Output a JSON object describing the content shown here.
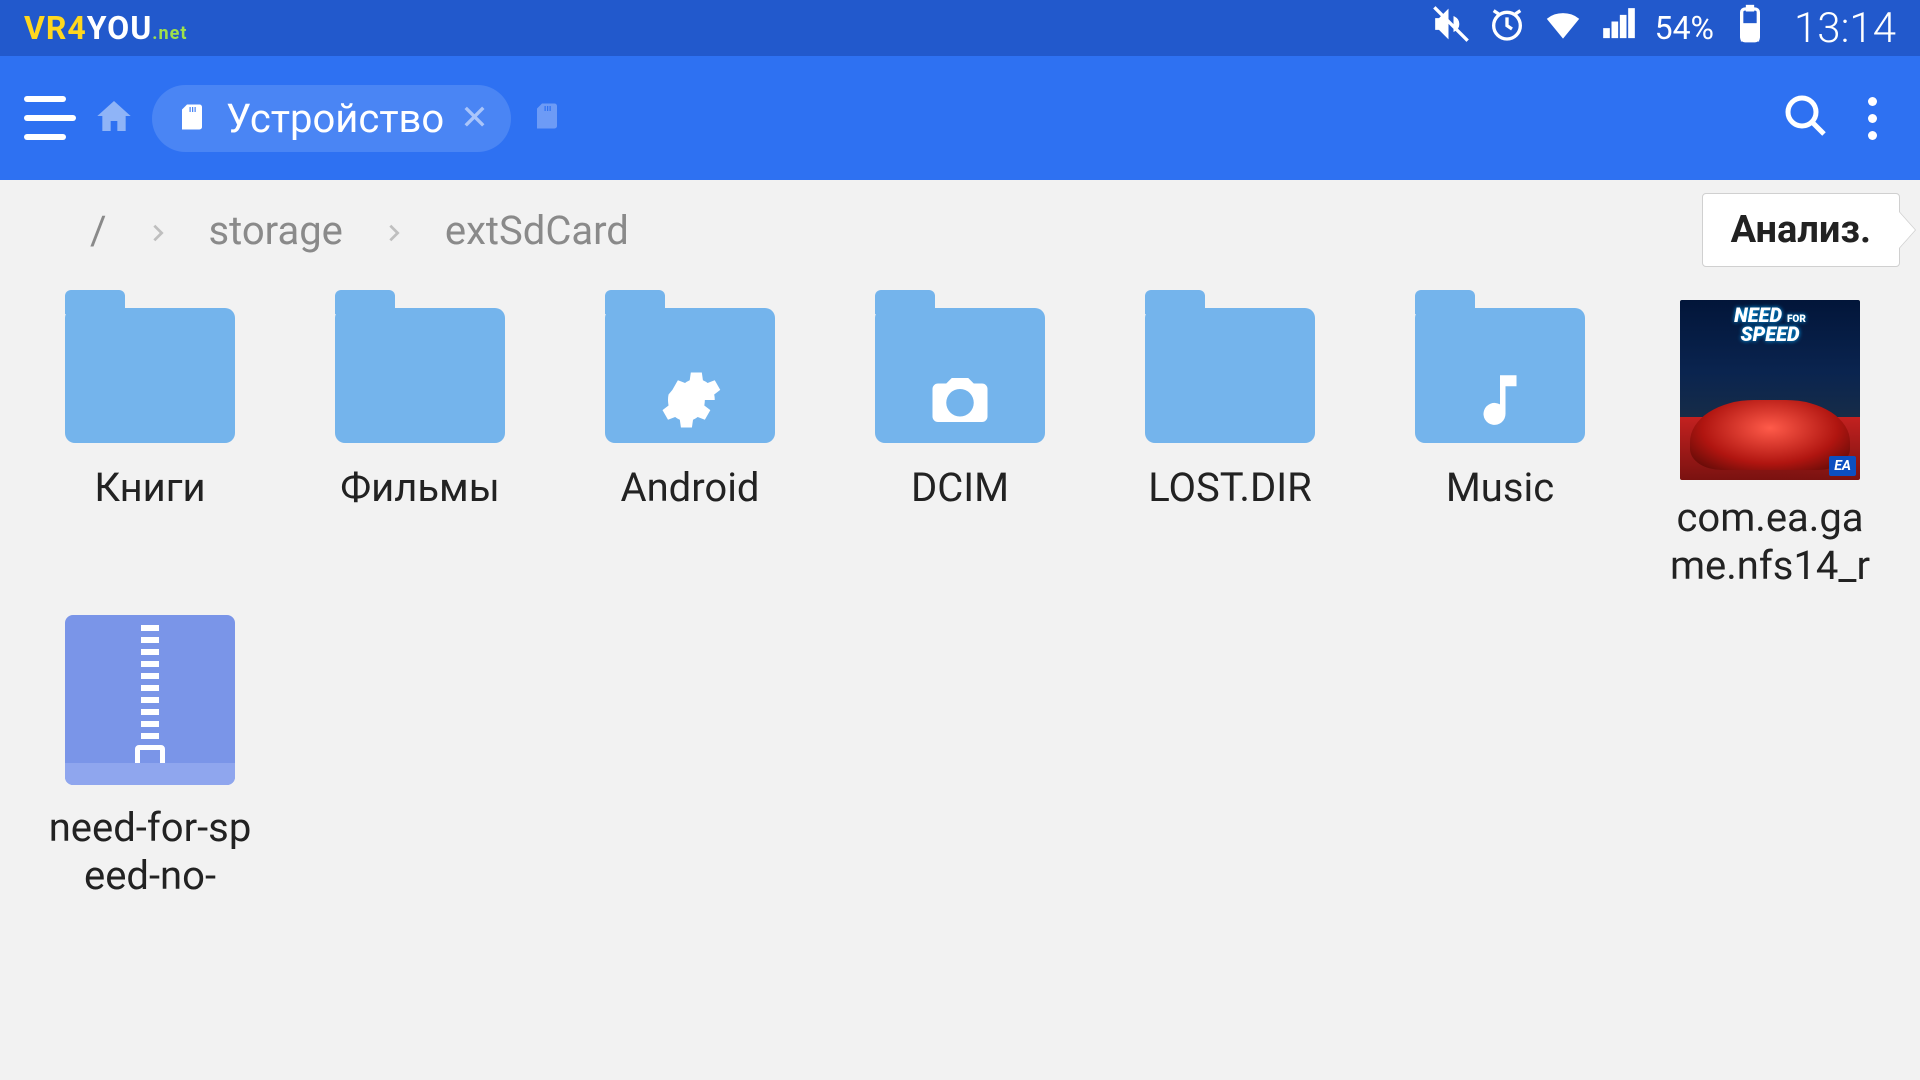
{
  "statusbar": {
    "logo_vr4": "VR4",
    "logo_you": "YOU",
    "logo_net": ".net",
    "battery_pct": "54%",
    "time": "13:14"
  },
  "toolbar": {
    "tab_label": "Устройство"
  },
  "breadcrumbs": [
    "/",
    "storage",
    "extSdCard"
  ],
  "analyze_label": "Анализ.",
  "items": [
    {
      "label": "Книги",
      "type": "folder",
      "overlay": null
    },
    {
      "label": "Фильмы",
      "type": "folder",
      "overlay": null
    },
    {
      "label": "Android",
      "type": "folder",
      "overlay": "gear"
    },
    {
      "label": "DCIM",
      "type": "folder",
      "overlay": "camera"
    },
    {
      "label": "LOST.DIR",
      "type": "folder",
      "overlay": null
    },
    {
      "label": "Music",
      "type": "folder",
      "overlay": "music"
    },
    {
      "label": "com.ea.game.nfs14_r",
      "type": "app",
      "overlay": null
    },
    {
      "label": "need-for-speed-no-",
      "type": "zip",
      "overlay": null
    }
  ],
  "app_thumb": {
    "title_line1": "NEED",
    "title_small": "FOR",
    "title_line2": "SPEED",
    "badge": "EA"
  }
}
